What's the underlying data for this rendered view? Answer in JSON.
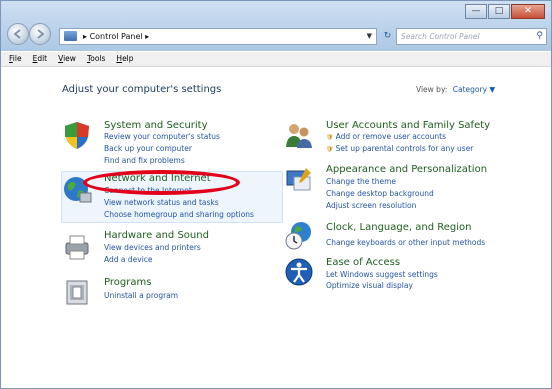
{
  "window": {
    "address": {
      "crumb": "Control Panel"
    },
    "search": {
      "placeholder": "Search Control Panel"
    }
  },
  "menubar": [
    "File",
    "Edit",
    "View",
    "Tools",
    "Help"
  ],
  "main": {
    "heading": "Adjust your computer's settings",
    "view_by": {
      "label": "View by:",
      "value": "Category"
    }
  },
  "categories": [
    {
      "title": "System and Security",
      "links": [
        "Review your computer's status",
        "Back up your computer",
        "Find and fix problems"
      ]
    },
    {
      "title": "Network and Internet",
      "links": [
        "Connect to the Internet",
        "View network status and tasks",
        "Choose homegroup and sharing options"
      ]
    },
    {
      "title": "Hardware and Sound",
      "links": [
        "View devices and printers",
        "Add a device"
      ]
    },
    {
      "title": "Programs",
      "links": [
        "Uninstall a program"
      ]
    },
    {
      "title": "User Accounts and Family Safety",
      "links": [
        "Add or remove user accounts",
        "Set up parental controls for any user"
      ]
    },
    {
      "title": "Appearance and Personalization",
      "links": [
        "Change the theme",
        "Change desktop background",
        "Adjust screen resolution"
      ]
    },
    {
      "title": "Clock, Language, and Region",
      "links": [
        "Change keyboards or other input methods"
      ]
    },
    {
      "title": "Ease of Access",
      "links": [
        "Let Windows suggest settings",
        "Optimize visual display"
      ]
    }
  ],
  "icons": {
    "system": "shield-icon",
    "network": "globe-network-icon",
    "hardware": "printer-icon",
    "programs": "programs-icon",
    "users": "users-icon",
    "appearance": "appearance-icon",
    "clock": "clock-globe-icon",
    "ease": "ease-of-access-icon"
  },
  "colors": {
    "title_bar": "#b9d1ea",
    "category_title": "#1e5d1e",
    "link": "#2456a0",
    "annotation": "#e2001a"
  }
}
